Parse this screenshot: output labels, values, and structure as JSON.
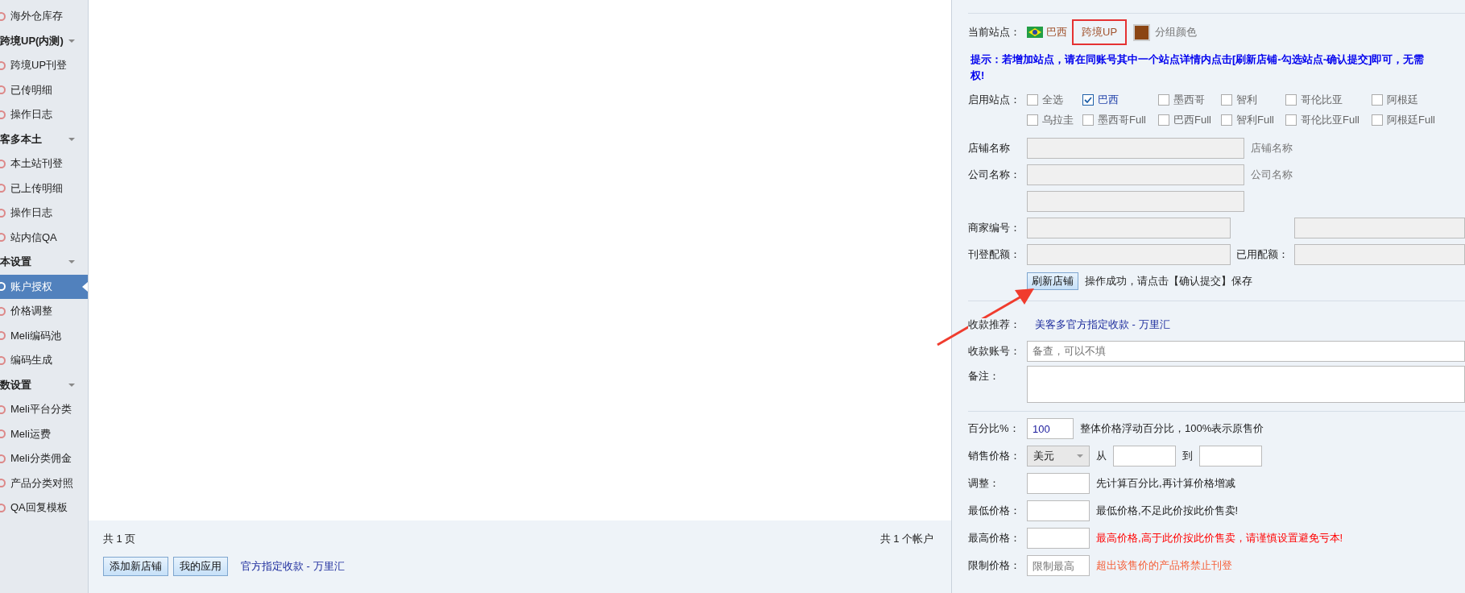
{
  "sidebar": {
    "items": [
      {
        "kind": "item",
        "label": "海外仓库存",
        "selected": false
      },
      {
        "kind": "group",
        "label": "跨境UP(内测)"
      },
      {
        "kind": "item",
        "label": "跨境UP刊登",
        "selected": false
      },
      {
        "kind": "item",
        "label": "已传明细",
        "selected": false
      },
      {
        "kind": "item",
        "label": "操作日志",
        "selected": false
      },
      {
        "kind": "group",
        "label": "客多本土"
      },
      {
        "kind": "item",
        "label": "本土站刊登",
        "selected": false
      },
      {
        "kind": "item",
        "label": "已上传明细",
        "selected": false
      },
      {
        "kind": "item",
        "label": "操作日志",
        "selected": false
      },
      {
        "kind": "item",
        "label": "站内信QA",
        "selected": false
      },
      {
        "kind": "group",
        "label": "本设置"
      },
      {
        "kind": "item",
        "label": "账户授权",
        "selected": true
      },
      {
        "kind": "item",
        "label": "价格调整",
        "selected": false
      },
      {
        "kind": "item",
        "label": "Meli编码池",
        "selected": false
      },
      {
        "kind": "item",
        "label": "编码生成",
        "selected": false
      },
      {
        "kind": "group",
        "label": "数设置"
      },
      {
        "kind": "item",
        "label": "Meli平台分类",
        "selected": false
      },
      {
        "kind": "item",
        "label": "Meli运费",
        "selected": false
      },
      {
        "kind": "item",
        "label": "Meli分类佣金",
        "selected": false
      },
      {
        "kind": "item",
        "label": "产品分类对照",
        "selected": false
      },
      {
        "kind": "item",
        "label": "QA回复模板",
        "selected": false
      }
    ]
  },
  "main": {
    "page_count": "共 1 页",
    "account_count": "共 1 个帐户",
    "buttons": [
      "添加新店铺",
      "我的应用"
    ],
    "link": "官方指定收款 - 万里汇"
  },
  "panel": {
    "current_site": {
      "label": "当前站点：",
      "site": "巴西",
      "group": "跨境UP",
      "group_highlighted": true,
      "color": "#8b4513",
      "color_label": "分组颜色"
    },
    "hint_lines": [
      "提示：若增加站点，请在同账号其中一个站点详情内点击[刷新店铺-勾选站点-确认提交]即可，无需",
      "权!"
    ],
    "sites": {
      "label": "启用站点：",
      "options": [
        {
          "label": "全选",
          "checked": false
        },
        {
          "label": "巴西",
          "checked": true
        },
        {
          "label": "墨西哥",
          "checked": false
        },
        {
          "label": "智利",
          "checked": false
        },
        {
          "label": "哥伦比亚",
          "checked": false
        },
        {
          "label": "阿根廷",
          "checked": false
        },
        {
          "label": "乌拉圭",
          "checked": false
        },
        {
          "label": "墨西哥Full",
          "checked": false
        },
        {
          "label": "巴西Full",
          "checked": false
        },
        {
          "label": "智利Full",
          "checked": false
        },
        {
          "label": "哥伦比亚Full",
          "checked": false
        },
        {
          "label": "阿根廷Full",
          "checked": false
        }
      ]
    },
    "shop_name": {
      "label": "店铺名称",
      "hint": "店铺名称"
    },
    "company_name": {
      "label": "公司名称：",
      "hint": "公司名称"
    },
    "merchant_id": {
      "label": "商家编号："
    },
    "quota": {
      "label": "刊登配额：",
      "used_label": "已用配额："
    },
    "refresh_button": "刷新店铺",
    "refresh_message": "操作成功，请点击【确认提交】保存",
    "payment": {
      "label": "收款推荐：",
      "link": "美客多官方指定收款 - 万里汇"
    },
    "account": {
      "label": "收款账号：",
      "placeholder": "备查，可以不填"
    },
    "note": {
      "label": "备注："
    },
    "percent": {
      "label": "百分比%：",
      "value": "100",
      "hint": "整体价格浮动百分比，100%表示原售价"
    },
    "sale_price": {
      "label": "销售价格：",
      "currency": "美元",
      "from": "从",
      "to": "到"
    },
    "price_rows": [
      {
        "label": "调整：",
        "hint": "先计算百分比,再计算价格增减",
        "color": "#222222"
      },
      {
        "label": "最低价格：",
        "hint": "最低价格,不足此价按此价售卖!",
        "color": "#222222"
      },
      {
        "label": "最高价格：",
        "hint": "最高价格,高于此价按此价售卖，请谨慎设置避免亏本!",
        "color": "#ff0000"
      },
      {
        "label": "限制价格：",
        "placeholder": "限制最高",
        "hint": "超出该售价的产品将禁止刊登",
        "color": "#f5603a"
      }
    ]
  }
}
